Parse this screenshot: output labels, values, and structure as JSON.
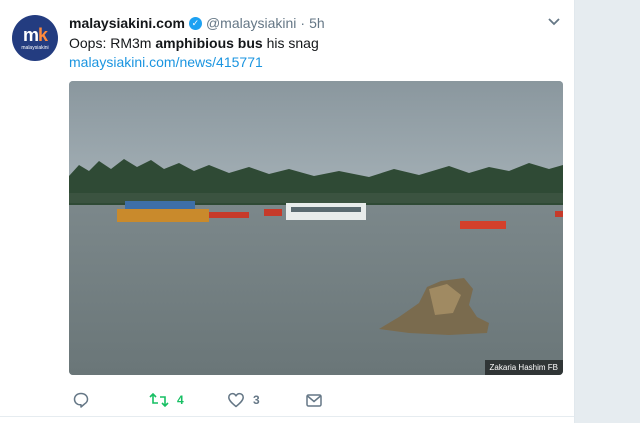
{
  "tweet": {
    "author_name": "malaysiakini.com",
    "handle": "@malaysiakini",
    "separator": "·",
    "time": "5h",
    "text_before": "Oops: RM3m ",
    "text_bold": "amphibious bus",
    "text_after": " his snag",
    "link": "malaysiakini.com/news/415771",
    "image_credit": "Zakaria Hashim FB"
  },
  "avatar": {
    "logo_m": "m",
    "logo_k": "k",
    "logo_label": "malaysiakini"
  },
  "actions": {
    "reply_count": "",
    "retweet_count": "4",
    "like_count": "3"
  },
  "icons": {
    "verified": "verified-badge-icon",
    "caret": "chevron-down-icon",
    "reply": "reply-icon",
    "retweet": "retweet-icon",
    "like": "heart-icon",
    "dm": "envelope-icon"
  },
  "colors": {
    "link": "#1b95e0",
    "retweet_green": "#17bf63",
    "muted": "#657786",
    "avatar_bg": "#233c80"
  }
}
